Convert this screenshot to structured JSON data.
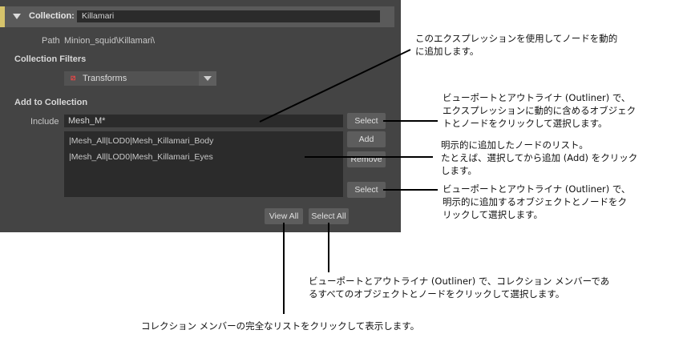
{
  "panel": {
    "collection_label": "Collection:",
    "collection_name": "Killamari",
    "path_label": "Path",
    "path_value": "Minion_squid\\Killamari\\",
    "filters_heading": "Collection Filters",
    "filter_dropdown_value": "Transforms",
    "add_heading": "Add to Collection",
    "include_label": "Include",
    "include_value": "Mesh_M*",
    "list_items": [
      "|Mesh_All|LOD0|Mesh_Killamari_Body",
      "|Mesh_All|LOD0|Mesh_Killamari_Eyes"
    ],
    "buttons": {
      "select_top": "Select",
      "add": "Add",
      "remove": "Remove",
      "select_bottom": "Select",
      "view_all": "View All",
      "select_all": "Select All"
    }
  },
  "callouts": {
    "expression": {
      "line1": "このエクスプレッションを使用してノードを動的",
      "line2": "に追加します。"
    },
    "select_include": {
      "line1": "ビューポートとアウトライナ (Outliner) で、",
      "line2": "エクスプレッションに動的に含めるオブジェク",
      "line3": "トとノードをクリックして選択します。"
    },
    "explicit_list": {
      "line1": "明示的に追加したノードのリスト。",
      "line2": "たとえば、選択してから追加 (Add) をクリック",
      "line3": "します。"
    },
    "select_explicit": {
      "line1": "ビューポートとアウトライナ (Outliner) で、",
      "line2": "明示的に追加するオブジェクトとノードをク",
      "line3": "リックして選択します。"
    },
    "select_all": {
      "line1": "ビューポートとアウトライナ (Outliner) で、コレクション メンバーであ",
      "line2": "るすべてのオブジェクトとノードをクリックして選択します。"
    },
    "view_all": {
      "line1": "コレクション メンバーの完全なリストをクリックして表示します。"
    }
  },
  "colors": {
    "panel_bg": "#444444",
    "header_accent": "#d6c36b",
    "field_bg": "#2b2b2b"
  }
}
